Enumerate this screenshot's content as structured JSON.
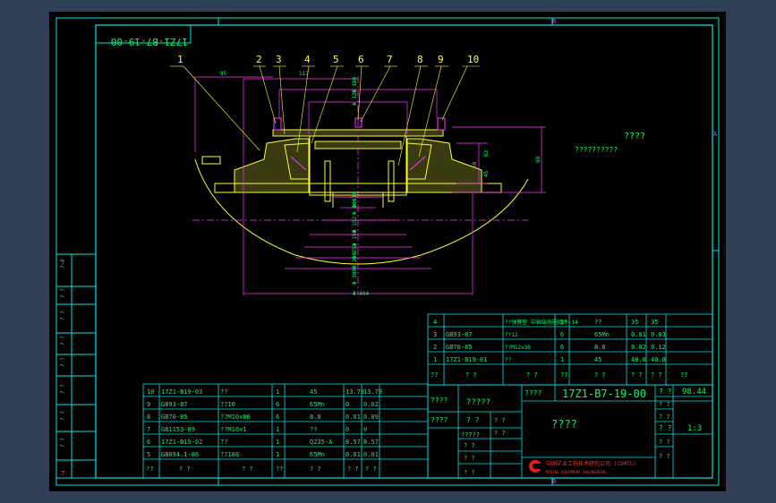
{
  "drawing": {
    "drawing_code_rotated": "17Z1-B7-19-00",
    "zone_top": "B",
    "zone_right": "A",
    "zone_bottom": "B",
    "zone_left_top": "7",
    "zone_left_bottom": "7",
    "tech_note_title": "????",
    "tech_note_text": "??????????"
  },
  "balloons": [
    "1",
    "2",
    "3",
    "4",
    "5",
    "6",
    "7",
    "8",
    "9",
    "10"
  ],
  "dims": {
    "d1": "85",
    "d2": "117",
    "d3": "Φ 180",
    "d4": "Φ 125",
    "d5": "Φ 206",
    "d6": "Φ 110",
    "d7": "Φ 152",
    "d8": "Φ 190",
    "d9": "Φ 253",
    "d10": "Φ 280",
    "d11": "Φ 380",
    "d12": "Φ 404",
    "v1": "62",
    "v2": "45",
    "v3": "50",
    "v4": "98"
  },
  "left_strip": [
    "? ?",
    "? ?",
    "? ?",
    "? ?",
    "? ?",
    "? ?",
    "? ?",
    "? ?"
  ],
  "parts_right": [
    {
      "no": "4",
      "code": "",
      "name": "??弹簧垫 中轴端挡圈组件-14",
      "qty": "1",
      "material": "??",
      "w1": "35",
      "w2": "35"
    },
    {
      "no": "3",
      "code": "GB93-87",
      "name": "??12",
      "qty": "6",
      "material": "65Mn",
      "w1": "0.01",
      "w2": "0.03"
    },
    {
      "no": "2",
      "code": "GB70-85",
      "name": "??M12x30",
      "qty": "6",
      "material": "8.8",
      "w1": "0.02",
      "w2": "0.12"
    },
    {
      "no": "1",
      "code": "17Z1-B19-01",
      "name": "??",
      "qty": "1",
      "material": "45",
      "w1": "40.8",
      "w2": "40.8"
    }
  ],
  "parts_right_header": [
    "??",
    "? ?",
    "? ?",
    "??",
    "? ?",
    "? ?",
    "? ?",
    "??"
  ],
  "parts_left": [
    {
      "no": "10",
      "code": "17Z1-B19-03",
      "name": "??",
      "qty": "1",
      "material": "45",
      "w1": "13.79",
      "w2": "13.79"
    },
    {
      "no": "9",
      "code": "GB93-87",
      "name": "??10",
      "qty": "6",
      "material": "65Mn",
      "w1": "0",
      "w2": "0.02"
    },
    {
      "no": "8",
      "code": "GB70-85",
      "name": "??M10x80",
      "qty": "6",
      "material": "8.8",
      "w1": "0.01",
      "w2": "0.09"
    },
    {
      "no": "7",
      "code": "GB1153-89",
      "name": "??M10x1",
      "qty": "1",
      "material": "??",
      "w1": "0",
      "w2": "0"
    },
    {
      "no": "6",
      "code": "17Z1-B19-02",
      "name": "??",
      "qty": "1",
      "material": "Q235-A",
      "w1": "8.57",
      "w2": "8.57"
    },
    {
      "no": "5",
      "code": "GB894.1-86",
      "name": "??180",
      "qty": "1",
      "material": "65Mn",
      "w1": "0.01",
      "w2": "0.01"
    }
  ],
  "parts_left_header": [
    "??",
    "? ?",
    "? ?",
    "??",
    "? ?",
    "? ?",
    "? ?"
  ],
  "title_block": {
    "drawing_no_label": "????",
    "drawing_no": "17Z1-B7-19-00",
    "weight_label": "? ?",
    "weight": "98.44",
    "scale_label": "? ?",
    "scale": "1:3",
    "part_name": "????",
    "left_col1": "????",
    "left_col1b": "?????",
    "left_col2": "????",
    "left_col2b": "? ?",
    "small_cells": [
      "? ?",
      "? ?",
      "?????",
      "? ?",
      "? ?",
      "? ?"
    ],
    "right_labels": [
      "? ?",
      "? ?",
      "? ?",
      "? ?"
    ],
    "company": "中国矿业工程技术研究公司 (CUMTC)",
    "company_en": "MINING EQUIPMENT ENGINEERING"
  },
  "colors": {
    "background": "#000000",
    "frame": "#00ffff",
    "geometry": "#ffff33",
    "dimension": "#ff33ff",
    "text": "#00ff66",
    "outer_bg": "#2f3f56"
  }
}
